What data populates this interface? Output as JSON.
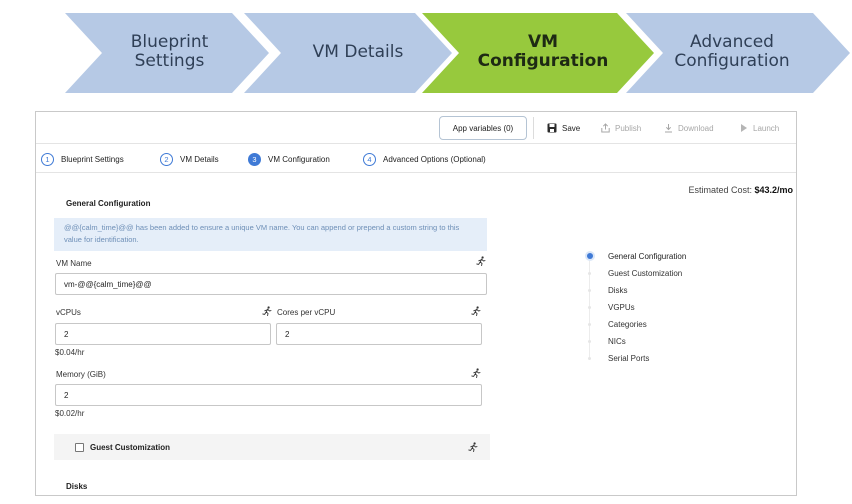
{
  "wizard_banner": {
    "steps": [
      {
        "line1": "Blueprint",
        "line2": "Settings"
      },
      {
        "line1": "VM Details",
        "line2": ""
      },
      {
        "line1": "VM",
        "line2": "Configuration"
      },
      {
        "line1": "Advanced",
        "line2": "Configuration"
      }
    ],
    "active_index": 2,
    "colors": {
      "inactive": "#b6c9e5",
      "active": "#97c93d"
    }
  },
  "toolbar": {
    "app_variables": "App variables (0)",
    "save": "Save",
    "publish": "Publish",
    "download": "Download",
    "launch": "Launch",
    "icons": [
      "save-icon",
      "publish-icon",
      "download-icon",
      "launch-icon"
    ]
  },
  "steps": [
    {
      "num": "1",
      "label": "Blueprint Settings"
    },
    {
      "num": "2",
      "label": "VM Details"
    },
    {
      "num": "3",
      "label": "VM Configuration"
    },
    {
      "num": "4",
      "label": "Advanced Options (Optional)"
    }
  ],
  "estimated_cost": {
    "label": "Estimated Cost: ",
    "value": "$43.2/mo"
  },
  "form": {
    "general_title": "General Configuration",
    "info_text": "@@{calm_time}@@ has been added to ensure a unique VM name. You can append or prepend a custom string to this value for identification.",
    "vm_name_label": "VM Name",
    "vm_name_value": "vm-@@{calm_time}@@",
    "vcpus_label": "vCPUs",
    "vcpus_value": "2",
    "vcpus_cost": "$0.04/hr",
    "cores_label": "Cores per vCPU",
    "cores_value": "2",
    "memory_label": "Memory (GiB)",
    "memory_value": "2",
    "memory_cost": "$0.02/hr",
    "guest_label": "Guest Customization",
    "disks_title": "Disks"
  },
  "right_nav": {
    "items": [
      "General Configuration",
      "Guest Customization",
      "Disks",
      "VGPUs",
      "Categories",
      "NICs",
      "Serial Ports"
    ],
    "active_index": 0
  },
  "colors": {
    "accent": "#3f7ad6",
    "info_bg": "#e5eef9",
    "info_text": "#6e8fb7"
  }
}
